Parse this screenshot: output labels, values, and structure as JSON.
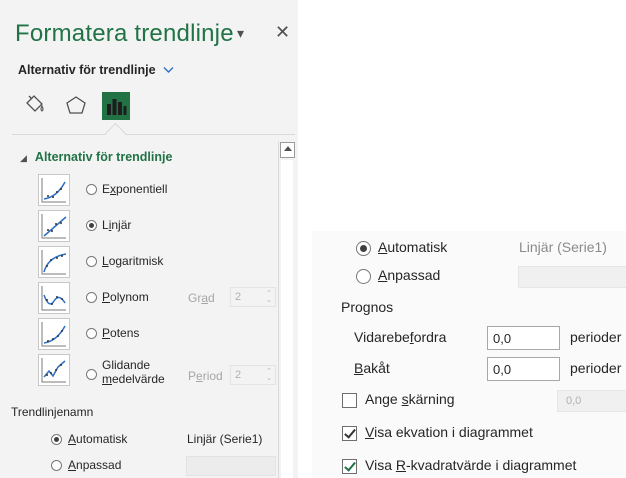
{
  "pane": {
    "title": "Formatera trendlinje",
    "dropdown_icon": "caret-down-icon",
    "close_icon": "close-icon",
    "subtitle": "Alternativ för trendlinje",
    "subtitle_chevron": "chevron-down-icon",
    "tabs": [
      {
        "icon": "paint-bucket-icon",
        "active": false
      },
      {
        "icon": "pentagon-icon",
        "active": false
      },
      {
        "icon": "bar-chart-icon",
        "active": true
      }
    ],
    "section_title": "Alternativ för trendlinje",
    "options": [
      {
        "label": "Exponentiell",
        "accel": "x",
        "checked": false
      },
      {
        "label": "Linjär",
        "accel": "i",
        "checked": true
      },
      {
        "label": "Logaritmisk",
        "accel": "L",
        "checked": false
      },
      {
        "label": "Polynom",
        "accel": "P",
        "checked": false,
        "param_label": "Grad",
        "param_value": "2"
      },
      {
        "label": "Potens",
        "accel": "P",
        "checked": false
      },
      {
        "label": "Glidande",
        "label2": "medelvärde",
        "checked": false,
        "param_label": "Period",
        "param_value": "2"
      }
    ],
    "name_section": "Trendlinjenamn",
    "name_auto": "Automatisk",
    "name_auto_value": "Linjär (Serie1)",
    "name_custom": "Anpassad"
  },
  "zoom": {
    "auto_label": "Automatisk",
    "auto_value": "Linjär (Serie1)",
    "custom_label": "Anpassad",
    "forecast": "Prognos",
    "forward_label": "Vidarebefordra",
    "forward_value": "0,0",
    "forward_unit": "perioder",
    "backward_label": "Bakåt",
    "backward_value": "0,0",
    "backward_unit": "perioder",
    "intercept_label": "Ange skärning",
    "intercept_value": "0,0",
    "show_equation": "Visa ekvation i diagrammet",
    "show_r2": "Visa R-kvadratvärde i diagrammet"
  },
  "colors": {
    "accent": "#217346",
    "pane_bg": "#f3f3f3"
  }
}
